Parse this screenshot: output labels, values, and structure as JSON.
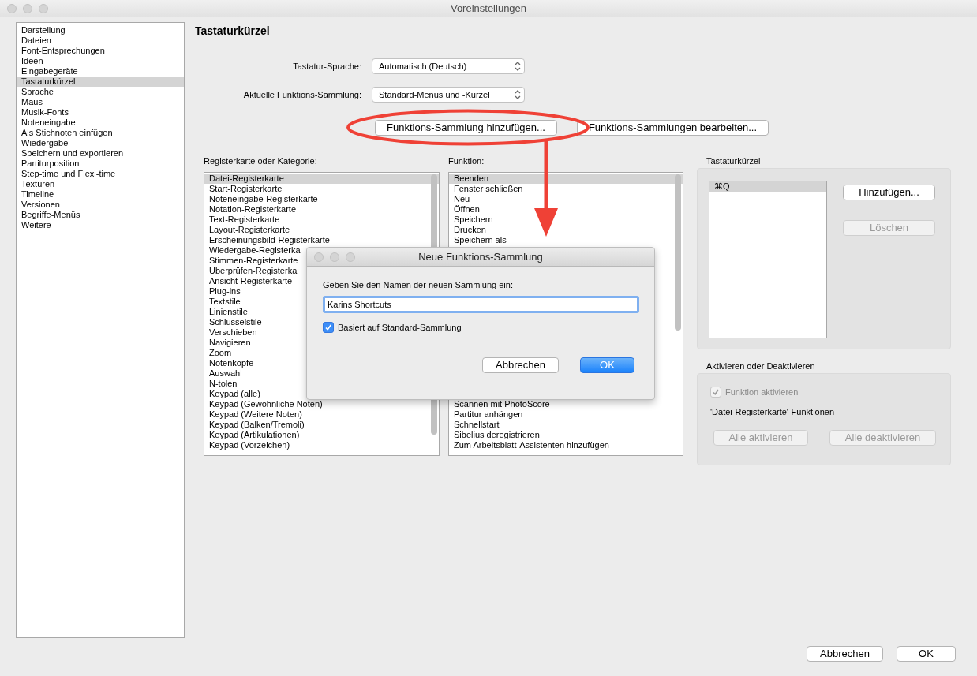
{
  "window": {
    "title": "Voreinstellungen"
  },
  "sidebar": {
    "items": [
      {
        "label": "Darstellung",
        "selected": false
      },
      {
        "label": "Dateien",
        "selected": false
      },
      {
        "label": "Font-Entsprechungen",
        "selected": false
      },
      {
        "label": "Ideen",
        "selected": false
      },
      {
        "label": "Eingabegeräte",
        "selected": false
      },
      {
        "label": "Tastaturkürzel",
        "selected": true
      },
      {
        "label": "Sprache",
        "selected": false
      },
      {
        "label": "Maus",
        "selected": false
      },
      {
        "label": "Musik-Fonts",
        "selected": false
      },
      {
        "label": "Noteneingabe",
        "selected": false
      },
      {
        "label": "Als Stichnoten einfügen",
        "selected": false
      },
      {
        "label": "Wiedergabe",
        "selected": false
      },
      {
        "label": "Speichern und exportieren",
        "selected": false
      },
      {
        "label": "Partiturposition",
        "selected": false
      },
      {
        "label": "Step-time und Flexi-time",
        "selected": false
      },
      {
        "label": "Texturen",
        "selected": false
      },
      {
        "label": "Timeline",
        "selected": false
      },
      {
        "label": "Versionen",
        "selected": false
      },
      {
        "label": "Begriffe-Menüs",
        "selected": false
      },
      {
        "label": "Weitere",
        "selected": false
      }
    ]
  },
  "page": {
    "title": "Tastaturkürzel",
    "fields": [
      {
        "label": "Tastatur-Sprache:",
        "value": "Automatisch (Deutsch)"
      },
      {
        "label": "Aktuelle Funktions-Sammlung:",
        "value": "Standard-Menüs und -Kürzel"
      }
    ],
    "collection_buttons": [
      "Funktions-Sammlung hinzufügen...",
      "Funktions-Sammlungen bearbeiten..."
    ],
    "categories": {
      "label": "Registerkarte oder Kategorie:",
      "items": [
        {
          "label": "Datei-Registerkarte",
          "selected": true
        },
        {
          "label": "Start-Registerkarte",
          "selected": false
        },
        {
          "label": "Noteneingabe-Registerkarte",
          "selected": false
        },
        {
          "label": "Notation-Registerkarte",
          "selected": false
        },
        {
          "label": "Text-Registerkarte",
          "selected": false
        },
        {
          "label": "Layout-Registerkarte",
          "selected": false
        },
        {
          "label": "Erscheinungsbild-Registerkarte",
          "selected": false
        },
        {
          "label": "Wiedergabe-Registerka",
          "selected": false
        },
        {
          "label": "Stimmen-Registerkarte",
          "selected": false
        },
        {
          "label": "Überprüfen-Registerka",
          "selected": false
        },
        {
          "label": "Ansicht-Registerkarte",
          "selected": false
        },
        {
          "label": "Plug-ins",
          "selected": false
        },
        {
          "label": "Textstile",
          "selected": false
        },
        {
          "label": "Linienstile",
          "selected": false
        },
        {
          "label": "Schlüsselstile",
          "selected": false
        },
        {
          "label": "Verschieben",
          "selected": false
        },
        {
          "label": "Navigieren",
          "selected": false
        },
        {
          "label": "Zoom",
          "selected": false
        },
        {
          "label": "Notenköpfe",
          "selected": false
        },
        {
          "label": "Auswahl",
          "selected": false
        },
        {
          "label": "N-tolen",
          "selected": false
        },
        {
          "label": "Keypad (alle)",
          "selected": false
        },
        {
          "label": "Keypad (Gewöhnliche Noten)",
          "selected": false
        },
        {
          "label": "Keypad (Weitere Noten)",
          "selected": false
        },
        {
          "label": "Keypad (Balken/Tremoli)",
          "selected": false
        },
        {
          "label": "Keypad (Artikulationen)",
          "selected": false
        },
        {
          "label": "Keypad (Vorzeichen)",
          "selected": false
        }
      ]
    },
    "functions": {
      "label": "Funktion:",
      "items_above_dialog": [
        {
          "label": "Beenden",
          "selected": true
        },
        {
          "label": "Fenster schließen",
          "selected": false
        },
        {
          "label": "Neu",
          "selected": false
        },
        {
          "label": "Öffnen",
          "selected": false
        },
        {
          "label": "Speichern",
          "selected": false
        },
        {
          "label": "Drucken",
          "selected": false
        },
        {
          "label": "Speichern als",
          "selected": false
        }
      ],
      "items_below_dialog": [
        {
          "label": "Scannen mit PhotoScore",
          "selected": false
        },
        {
          "label": "Partitur anhängen",
          "selected": false
        },
        {
          "label": "Schnellstart",
          "selected": false
        },
        {
          "label": "Sibelius deregistrieren",
          "selected": false
        },
        {
          "label": "Zum Arbeitsblatt-Assistenten hinzufügen",
          "selected": false
        }
      ]
    },
    "shortcuts": {
      "title": "Tastaturkürzel",
      "items": [
        {
          "label": "⌘Q",
          "selected": true
        }
      ],
      "buttons": [
        {
          "label": "Hinzufügen...",
          "disabled": false
        },
        {
          "label": "Löschen",
          "disabled": true
        }
      ]
    },
    "activation": {
      "title": "Aktivieren oder Deaktivieren",
      "checkbox": {
        "label": "Funktion aktivieren",
        "checked": true,
        "disabled": true
      },
      "caption": "'Datei-Registerkarte'-Funktionen",
      "buttons": [
        {
          "label": "Alle aktivieren",
          "disabled": true
        },
        {
          "label": "Alle deaktivieren",
          "disabled": true
        }
      ]
    },
    "footer_buttons": [
      "Abbrechen",
      "OK"
    ]
  },
  "dialog": {
    "title": "Neue Funktions-Sammlung",
    "prompt": "Geben Sie den Namen der neuen Sammlung ein:",
    "name_field": {
      "value": "Karins Shortcuts"
    },
    "checkbox": {
      "label": "Basiert auf Standard-Sammlung",
      "checked": true
    },
    "buttons": [
      {
        "label": "Abbrechen",
        "default": false
      },
      {
        "label": "OK",
        "default": true
      }
    ]
  }
}
